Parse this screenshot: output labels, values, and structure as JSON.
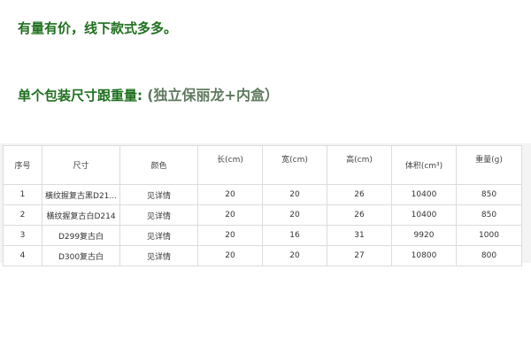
{
  "text": {
    "line1": "有量有价，线下款式多多。",
    "line2_main": "单个包装尺寸跟重量: ",
    "line2_paren": "(独立保丽龙+内盒）"
  },
  "table": {
    "headers": [
      "序号",
      "尺寸",
      "颜色",
      "长(cm)",
      "宽(cm)",
      "高(cm)",
      "体积(cm³)",
      "重量(g)"
    ],
    "rows": [
      [
        "1",
        "橫纹握复古黑D21...",
        "见详情",
        "20",
        "20",
        "26",
        "10400",
        "850"
      ],
      [
        "2",
        "橫纹握复古白D214",
        "见详情",
        "20",
        "20",
        "26",
        "10400",
        "850"
      ],
      [
        "3",
        "D299复古白",
        "见详情",
        "20",
        "16",
        "31",
        "9920",
        "1000"
      ],
      [
        "4",
        "D300复古白",
        "见详情",
        "20",
        "20",
        "27",
        "10800",
        "800"
      ]
    ]
  },
  "colors": {
    "heading_green": "#1f6f1f",
    "paren_green": "#5f7a5f",
    "border": "#dcdcdc"
  }
}
